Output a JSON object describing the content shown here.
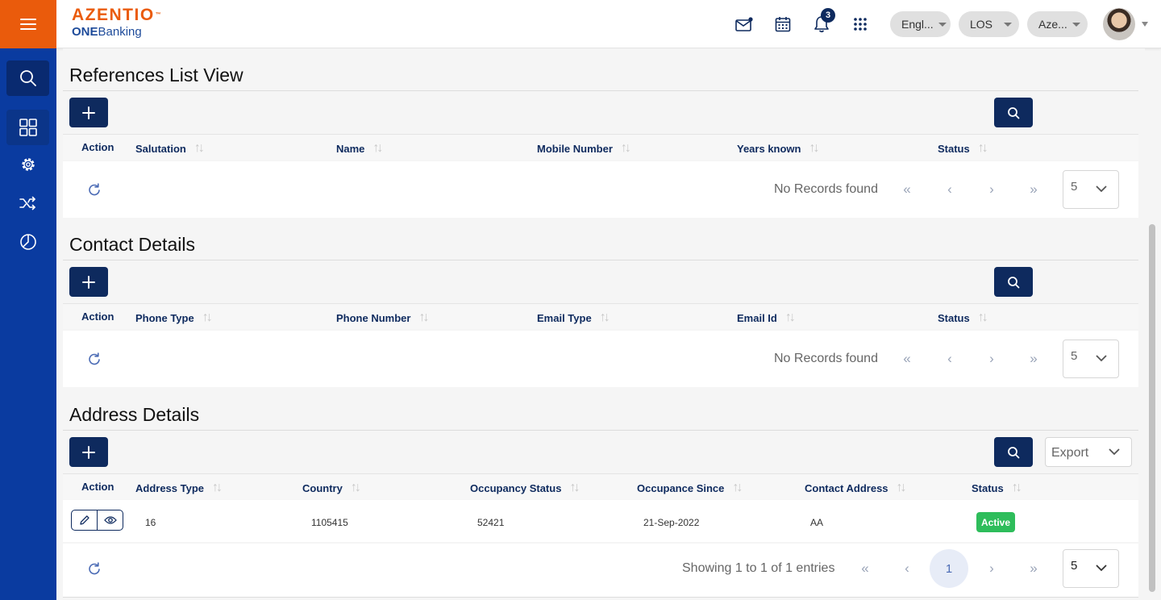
{
  "header": {
    "logo_main": "AZENTIO",
    "logo_tm": "™",
    "logo_sub_bold": "ONE",
    "logo_sub_rest": "Banking",
    "notification_count": "3",
    "language": "Engl...",
    "module": "LOS",
    "entity": "Aze..."
  },
  "sidebar": {
    "items": [
      "search-icon",
      "dashboard-icon",
      "settings-icon",
      "shuffle-icon",
      "pie-chart-icon"
    ]
  },
  "colors": {
    "brand_orange": "#ea5b0c",
    "sidebar_blue": "#0a3ba0",
    "navy": "#0e2a5e",
    "status_active": "#2ebd5b"
  },
  "references": {
    "title": "References List View",
    "columns": [
      "Action",
      "Salutation",
      "Name",
      "Mobile Number",
      "Years known",
      "Status"
    ],
    "empty_text": "No Records found",
    "page_size": "5"
  },
  "contacts": {
    "title": "Contact Details",
    "columns": [
      "Action",
      "Phone Type",
      "Phone Number",
      "Email Type",
      "Email Id",
      "Status"
    ],
    "empty_text": "No Records found",
    "page_size": "5"
  },
  "address": {
    "title": "Address Details",
    "export_label": "Export",
    "columns": [
      "Action",
      "Address Type",
      "Country",
      "Occupancy Status",
      "Occupance Since",
      "Contact Address",
      "Status"
    ],
    "rows": [
      {
        "address_type": "16",
        "country": "1105415",
        "occupancy_status": "52421",
        "occupance_since": "21-Sep-2022",
        "contact_address": "AA",
        "status": "Active"
      }
    ],
    "showing_text": "Showing 1 to 1 of 1 entries",
    "current_page": "1",
    "page_size": "5"
  },
  "pager": {
    "first": "«",
    "prev": "‹",
    "next": "›",
    "last": "»"
  }
}
